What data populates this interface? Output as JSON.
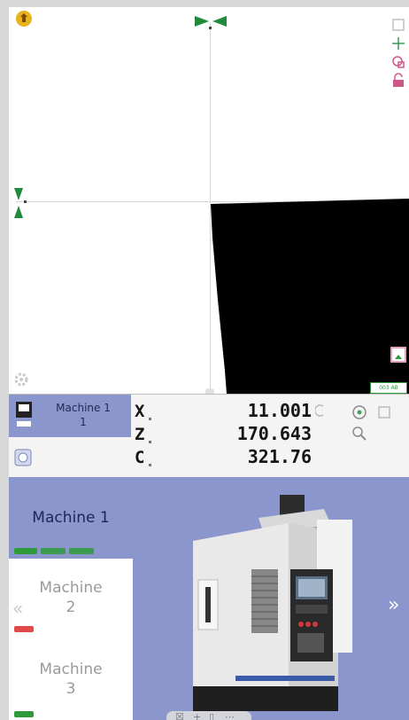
{
  "viewer": {
    "status_tag": "003 AB"
  },
  "dro": {
    "machine_name": "Machine 1",
    "machine_number": "1",
    "axes": [
      {
        "letter": "X",
        "value": "11.001"
      },
      {
        "letter": "Z",
        "value": "170.643"
      },
      {
        "letter": "C",
        "value": "321.76"
      }
    ]
  },
  "machines": {
    "active": {
      "name": "Machine 1",
      "status_pills": [
        "#2e9a3a",
        "#2e9a3a",
        "#2e9a3a"
      ]
    },
    "list": [
      {
        "name_line1": "Machine",
        "name_line2": "2",
        "status_color": "#e04a4a"
      },
      {
        "name_line1": "Machine",
        "name_line2": "3",
        "status_color": "#2e9a3a"
      }
    ],
    "prev_label": "«",
    "next_label": "»"
  },
  "colors": {
    "panel_blue": "#8b96cd",
    "marker_green": "#1f8a3c",
    "tool_pink": "#d0568a",
    "status_green": "#2e9a3a",
    "status_red": "#e04a4a"
  },
  "icons": {
    "logo": "logo-icon",
    "gear": "gear-icon",
    "camera": "camera-icon",
    "machine_tile": "machine-display-icon",
    "zoom": "zoom-icon",
    "target": "target-icon",
    "stop": "stop-icon"
  }
}
